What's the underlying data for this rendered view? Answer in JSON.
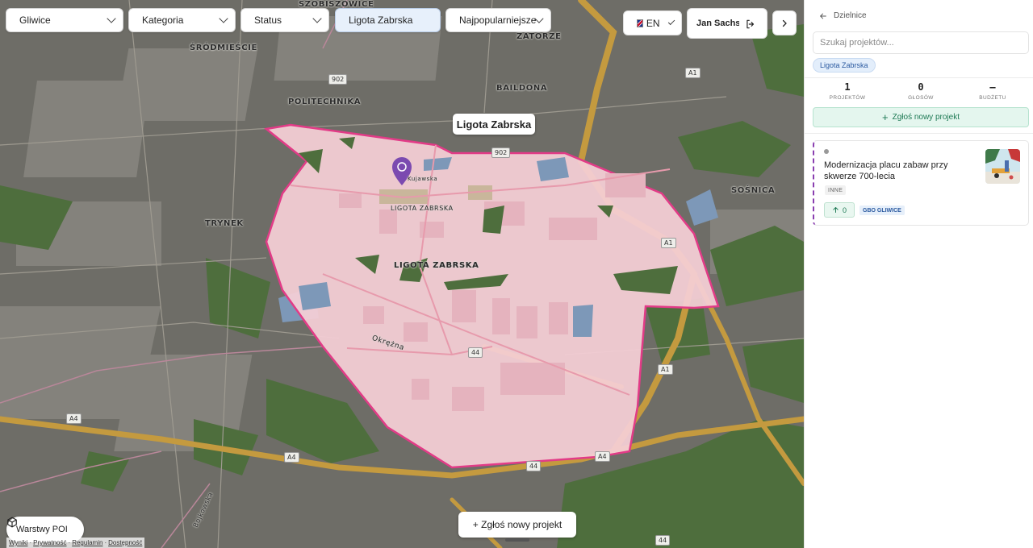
{
  "filters": {
    "city": "Gliwice",
    "category": "Kategoria",
    "status": "Status",
    "district": "Ligota Zabrska",
    "sort": "Najpopularniejsze"
  },
  "language": "EN",
  "user": {
    "name": "Jan Sachse"
  },
  "map": {
    "district_label": "Ligota Zabrska",
    "place_labels": {
      "szobiszowice": "SZOBISZOWICE",
      "zatorze": "ZATORZE",
      "srodmiescie": "ŚRÓDMIEŚCIE",
      "baildona": "BAILDONA",
      "politechnika": "POLITECHNIKA",
      "sosnica": "SOŚNICA",
      "trynek": "TRYNEK",
      "ligota_area": "LIGOTA ZABRSKA",
      "ligota_street": "LIGOTA ZABRSKA",
      "okrezna": "Okrężna",
      "kujawska": "Kujawska",
      "bojkowska": "Bojkowska"
    },
    "road_shields": {
      "r902a": "902",
      "r902b": "902",
      "a1a": "A1",
      "a1b": "A1",
      "a1c": "A1",
      "r44a": "44",
      "r44b": "44",
      "r44c": "44",
      "a4a": "A4",
      "a4b": "A4",
      "a4c": "A4"
    },
    "poi_layers_label": "Warstwy POI",
    "submit_label": "+ Zgłoś nowy projekt",
    "footer_links": [
      "Wyniki",
      "Prywatność",
      "Regulamin",
      "Dostępność"
    ],
    "colors": {
      "district_fill": "#f5cfd6",
      "district_stroke": "#e23b87",
      "forest": "#4e6e3d",
      "highway": "#c79a3c",
      "pin": "#7b4ab0"
    }
  },
  "sidebar": {
    "back_label": "Dzielnice",
    "search_placeholder": "Szukaj projektów...",
    "active_chip": "Ligota Zabrska",
    "stats": [
      {
        "value": "1",
        "label": "PROJEKTÓW"
      },
      {
        "value": "0",
        "label": "GŁOSÓW"
      },
      {
        "value": "–",
        "label": "BUDŻETU"
      }
    ],
    "new_project_label": "Zgłoś nowy projekt",
    "projects": [
      {
        "title": "Modernizacja placu zabaw przy skwerze 700-lecia",
        "category": "INNE",
        "votes": "0",
        "badge": "GBO GLIWICE"
      }
    ],
    "colors": {
      "accent_green": "#1f7a55",
      "card_border": "#8a3fb0",
      "chip_blue": "#2b5aa0"
    }
  }
}
